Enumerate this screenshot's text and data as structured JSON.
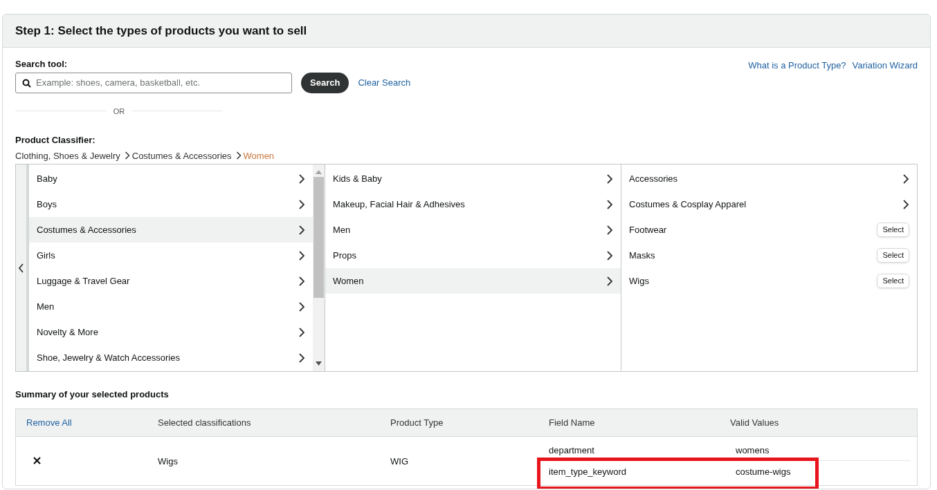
{
  "title": "Step 1: Select the types of products you want to sell",
  "search": {
    "label": "Search tool:",
    "placeholder": "Example: shoes, camera, basketball, etc.",
    "button": "Search",
    "clear": "Clear Search"
  },
  "help_links": [
    "What is a Product Type?",
    "Variation Wizard"
  ],
  "divider_text": "OR",
  "classifier": {
    "label": "Product Classifier:",
    "breadcrumb": [
      {
        "label": "Clothing, Shoes & Jewelry",
        "current": false
      },
      {
        "label": "Costumes & Accessories",
        "current": false
      },
      {
        "label": "Women",
        "current": true
      }
    ],
    "columns": [
      {
        "items": [
          {
            "label": "Baby",
            "kind": "branch",
            "selected": false
          },
          {
            "label": "Boys",
            "kind": "branch",
            "selected": false
          },
          {
            "label": "Costumes & Accessories",
            "kind": "branch",
            "selected": true
          },
          {
            "label": "Girls",
            "kind": "branch",
            "selected": false
          },
          {
            "label": "Luggage & Travel Gear",
            "kind": "branch",
            "selected": false
          },
          {
            "label": "Men",
            "kind": "branch",
            "selected": false
          },
          {
            "label": "Novelty & More",
            "kind": "branch",
            "selected": false
          },
          {
            "label": "Shoe, Jewelry & Watch Accessories",
            "kind": "branch",
            "selected": false
          }
        ]
      },
      {
        "items": [
          {
            "label": "Kids & Baby",
            "kind": "branch",
            "selected": false
          },
          {
            "label": "Makeup, Facial Hair & Adhesives",
            "kind": "branch",
            "selected": false
          },
          {
            "label": "Men",
            "kind": "branch",
            "selected": false
          },
          {
            "label": "Props",
            "kind": "branch",
            "selected": false
          },
          {
            "label": "Women",
            "kind": "branch",
            "selected": true
          }
        ]
      },
      {
        "items": [
          {
            "label": "Accessories",
            "kind": "branch",
            "selected": false
          },
          {
            "label": "Costumes & Cosplay Apparel",
            "kind": "branch",
            "selected": false
          },
          {
            "label": "Footwear",
            "kind": "leaf",
            "selected": false,
            "button": "Select"
          },
          {
            "label": "Masks",
            "kind": "leaf",
            "selected": false,
            "button": "Select"
          },
          {
            "label": "Wigs",
            "kind": "leaf",
            "selected": false,
            "button": "Select"
          }
        ]
      }
    ]
  },
  "summary": {
    "title": "Summary of your selected products",
    "columns": [
      "Remove All",
      "Selected classifications",
      "Product Type",
      "Field Name",
      "Valid Values"
    ],
    "rows": [
      {
        "classification": "Wigs",
        "product_type": "WIG",
        "fields": [
          {
            "name": "department",
            "value": "womens",
            "highlighted": false
          },
          {
            "name": "item_type_keyword",
            "value": "costume-wigs",
            "highlighted": true
          }
        ]
      }
    ]
  }
}
